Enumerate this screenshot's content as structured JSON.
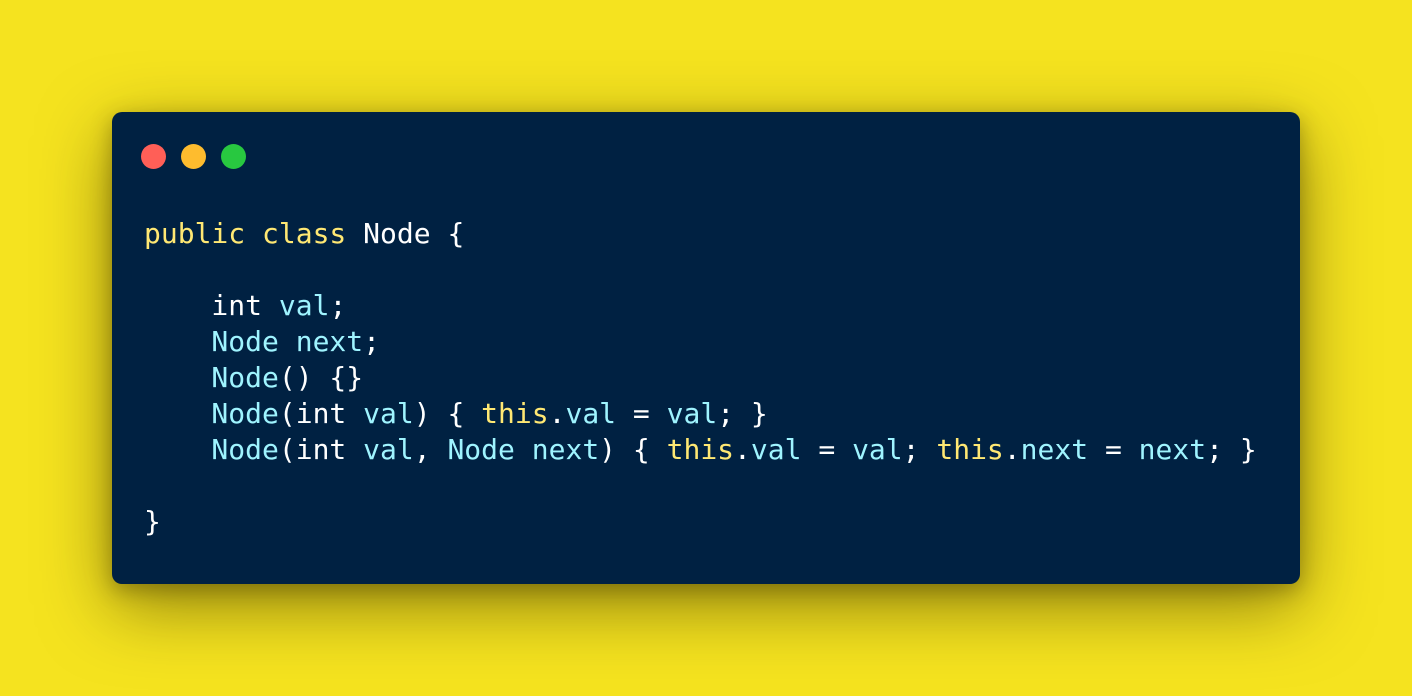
{
  "window": {
    "controls": [
      {
        "name": "close",
        "color": "#ff5f57"
      },
      {
        "name": "minimize",
        "color": "#febc2e"
      },
      {
        "name": "maximize",
        "color": "#28c840"
      }
    ]
  },
  "colors": {
    "background": "#f5e31f",
    "editor": "#002142",
    "keyword": "#ffe873",
    "identifier": "#9ff4ff",
    "plain": "#ffffff"
  },
  "code": {
    "language": "java",
    "lines": [
      [
        {
          "t": "public class",
          "k": "kw"
        },
        {
          "t": " Node {",
          "k": "pl"
        }
      ],
      [],
      [
        {
          "t": "    int ",
          "k": "pl"
        },
        {
          "t": "val",
          "k": "id"
        },
        {
          "t": ";",
          "k": "pl"
        }
      ],
      [
        {
          "t": "    Node next",
          "k": "id"
        },
        {
          "t": ";",
          "k": "pl"
        }
      ],
      [
        {
          "t": "    Node",
          "k": "id"
        },
        {
          "t": "() {}",
          "k": "pl"
        }
      ],
      [
        {
          "t": "    Node",
          "k": "id"
        },
        {
          "t": "(int ",
          "k": "pl"
        },
        {
          "t": "val",
          "k": "id"
        },
        {
          "t": ") { ",
          "k": "pl"
        },
        {
          "t": "this",
          "k": "kw"
        },
        {
          "t": ".",
          "k": "pl"
        },
        {
          "t": "val",
          "k": "id"
        },
        {
          "t": " = ",
          "k": "pl"
        },
        {
          "t": "val",
          "k": "id"
        },
        {
          "t": "; }",
          "k": "pl"
        }
      ],
      [
        {
          "t": "    Node",
          "k": "id"
        },
        {
          "t": "(int ",
          "k": "pl"
        },
        {
          "t": "val",
          "k": "id"
        },
        {
          "t": ", ",
          "k": "pl"
        },
        {
          "t": "Node next",
          "k": "id"
        },
        {
          "t": ") { ",
          "k": "pl"
        },
        {
          "t": "this",
          "k": "kw"
        },
        {
          "t": ".",
          "k": "pl"
        },
        {
          "t": "val",
          "k": "id"
        },
        {
          "t": " = ",
          "k": "pl"
        },
        {
          "t": "val",
          "k": "id"
        },
        {
          "t": "; ",
          "k": "pl"
        },
        {
          "t": "this",
          "k": "kw"
        },
        {
          "t": ".",
          "k": "pl"
        },
        {
          "t": "next",
          "k": "id"
        },
        {
          "t": " = ",
          "k": "pl"
        },
        {
          "t": "next",
          "k": "id"
        },
        {
          "t": "; }",
          "k": "pl"
        }
      ],
      [],
      [
        {
          "t": "}",
          "k": "pl"
        }
      ]
    ]
  }
}
